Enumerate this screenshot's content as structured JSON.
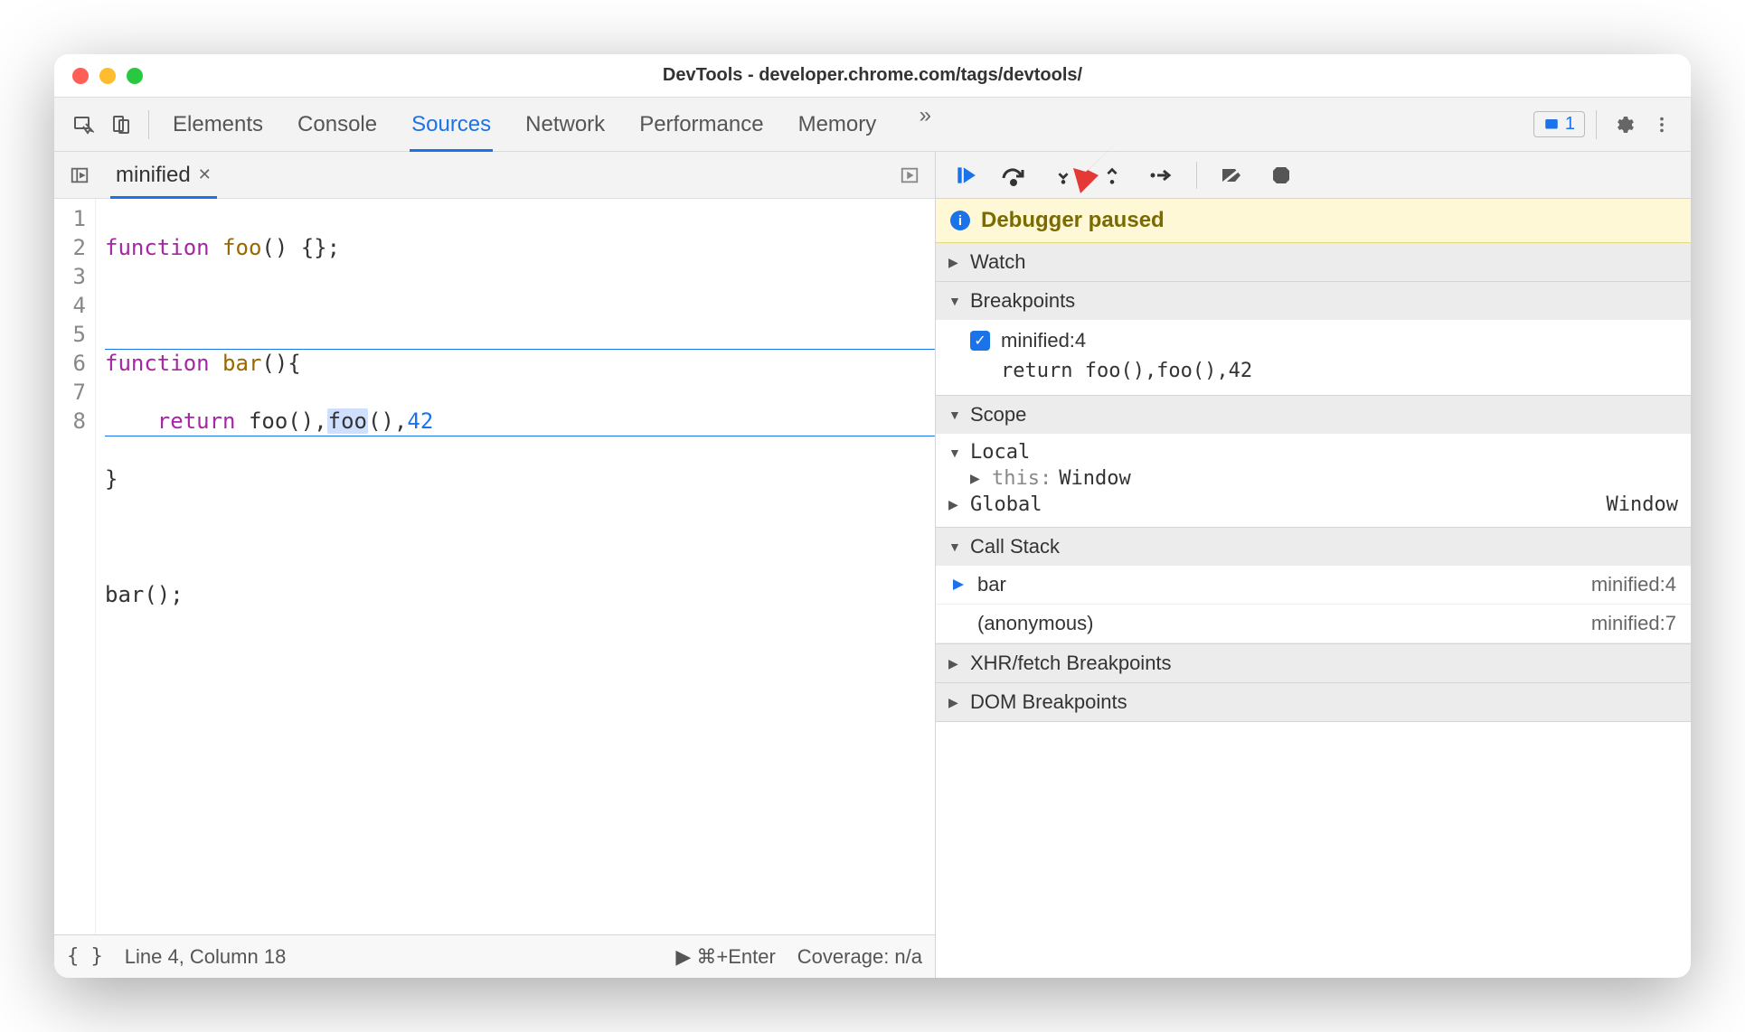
{
  "window": {
    "title": "DevTools - developer.chrome.com/tags/devtools/"
  },
  "tabs": {
    "items": [
      "Elements",
      "Console",
      "Sources",
      "Network",
      "Performance",
      "Memory"
    ],
    "active": "Sources",
    "more": "»"
  },
  "issues": {
    "count": "1"
  },
  "editorTabs": {
    "file": "minified"
  },
  "code": {
    "lines": [
      "1",
      "2",
      "3",
      "4",
      "5",
      "6",
      "7",
      "8"
    ],
    "l1_kw": "function",
    "l1_fn": "foo",
    "l1_rest": "() {};",
    "l3_kw": "function",
    "l3_fn": "bar",
    "l3_rest": "(){",
    "l4_ret": "return",
    "l4_a": " foo(),",
    "l4_sel": "foo",
    "l4_b": "(),",
    "l4_num": "42",
    "l5": "}",
    "l7": "bar();"
  },
  "status": {
    "pos": "Line 4, Column 18",
    "run": "⌘+Enter",
    "coverage": "Coverage: n/a",
    "braces": "{ }"
  },
  "debugger": {
    "bannerLabel": "Debugger paused",
    "sections": {
      "watch": "Watch",
      "breakpoints": "Breakpoints",
      "scope": "Scope",
      "callstack": "Call Stack",
      "xhr": "XHR/fetch Breakpoints",
      "dom": "DOM Breakpoints"
    },
    "breakpoint": {
      "label": "minified:4",
      "code": "return foo(),foo(),42"
    },
    "scope": {
      "local": "Local",
      "thisLabel": "this",
      "thisVal": "Window",
      "global": "Global",
      "globalVal": "Window"
    },
    "stack": [
      {
        "name": "bar",
        "loc": "minified:4"
      },
      {
        "name": "(anonymous)",
        "loc": "minified:7"
      }
    ]
  }
}
